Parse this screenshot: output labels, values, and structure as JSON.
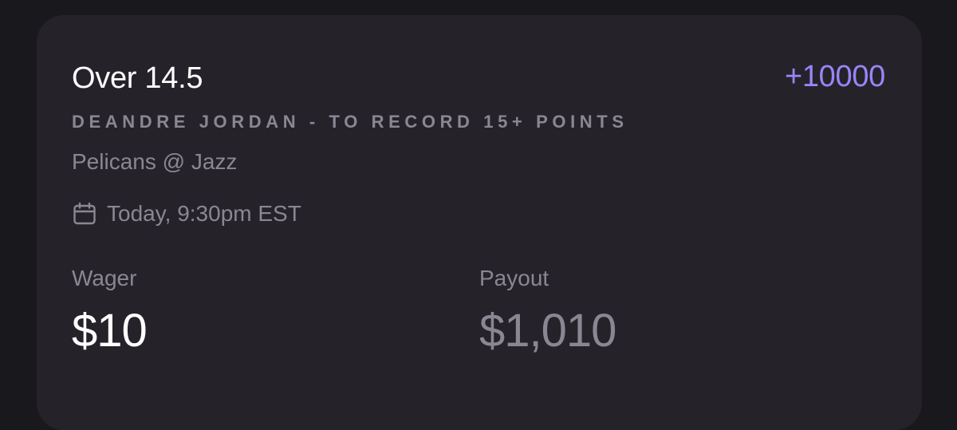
{
  "bet": {
    "selection": "Over 14.5",
    "odds": "+10000",
    "market": "DEANDRE JORDAN - TO RECORD 15+ POINTS",
    "matchup": "Pelicans @ Jazz",
    "datetime": "Today, 9:30pm EST"
  },
  "wager": {
    "label": "Wager",
    "amount": "$10"
  },
  "payout": {
    "label": "Payout",
    "amount": "$1,010"
  },
  "icons": {
    "calendar": "calendar-icon"
  },
  "colors": {
    "background": "#19181c",
    "card": "#252329",
    "accent": "#9b84f8",
    "muted_text": "#8a8793",
    "primary_text": "#ffffff"
  }
}
